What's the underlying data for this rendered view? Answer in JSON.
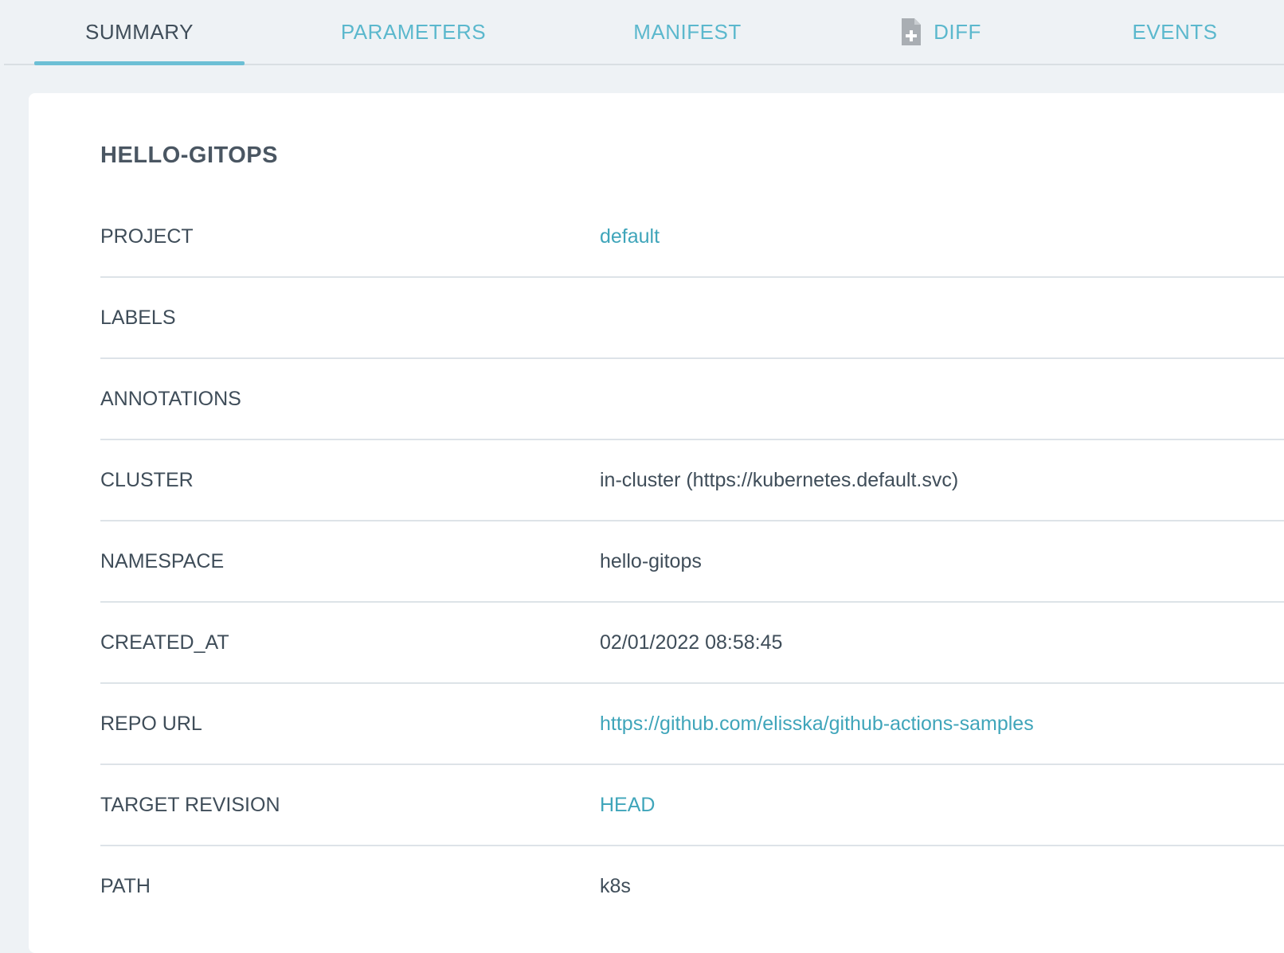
{
  "tabs": [
    {
      "label": "SUMMARY",
      "active": true
    },
    {
      "label": "PARAMETERS",
      "active": false
    },
    {
      "label": "MANIFEST",
      "active": false
    },
    {
      "label": "DIFF",
      "active": false,
      "icon": "file-plus-icon"
    },
    {
      "label": "EVENTS",
      "active": false
    }
  ],
  "summary": {
    "title": "HELLO-GITOPS",
    "rows": [
      {
        "key": "PROJECT",
        "value": "default"
      },
      {
        "key": "LABELS",
        "value": ""
      },
      {
        "key": "ANNOTATIONS",
        "value": ""
      },
      {
        "key": "CLUSTER",
        "value": "in-cluster (https://kubernetes.default.svc)"
      },
      {
        "key": "NAMESPACE",
        "value": "hello-gitops"
      },
      {
        "key": "CREATED_AT",
        "value": "02/01/2022 08:58:45"
      },
      {
        "key": "REPO URL",
        "value": "https://github.com/elisska/github-actions-samples"
      },
      {
        "key": "TARGET REVISION",
        "value": "HEAD"
      },
      {
        "key": "PATH",
        "value": "k8s"
      }
    ]
  },
  "colors": {
    "accent": "#5bb8cd",
    "link": "#3fa5ba",
    "text": "#3f4d59",
    "background": "#eef2f5"
  }
}
